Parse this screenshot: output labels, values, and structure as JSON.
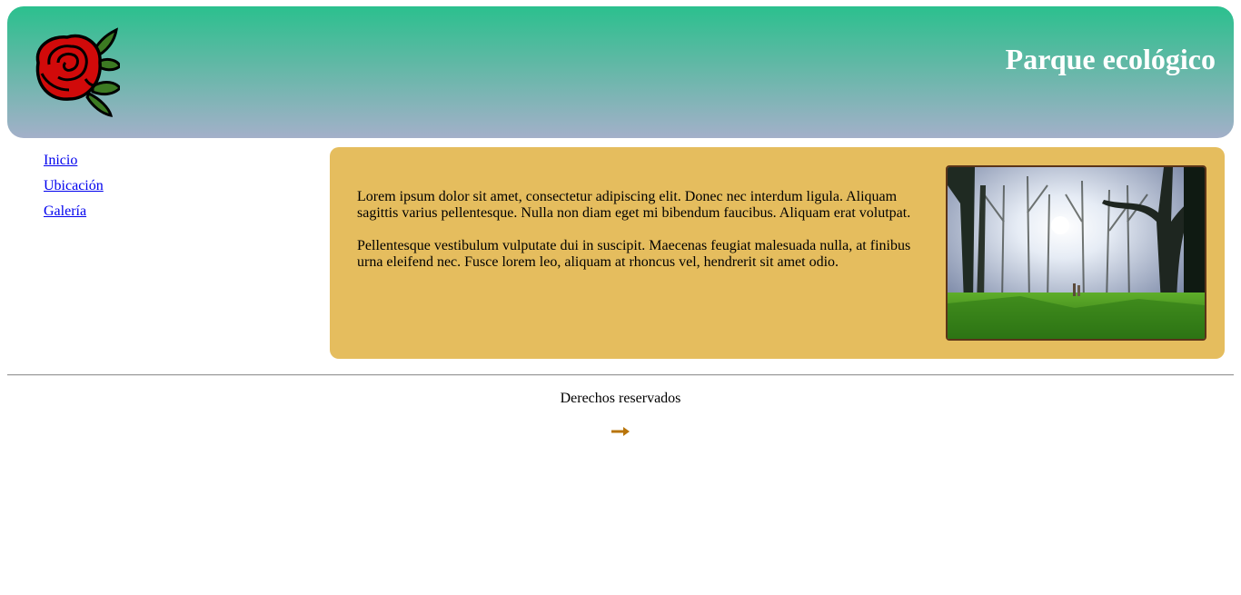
{
  "header": {
    "title": "Parque ecológico",
    "logo_icon": "rose-icon"
  },
  "nav": {
    "items": [
      {
        "label": "Inicio"
      },
      {
        "label": "Ubicación"
      },
      {
        "label": "Galería"
      }
    ]
  },
  "main": {
    "paragraphs": [
      "Lorem ipsum dolor sit amet, consectetur adipiscing elit. Donec nec interdum ligula. Aliquam sagittis varius pellentesque. Nulla non diam eget mi bibendum faucibus. Aliquam erat volutpat.",
      "Pellentesque vestibulum vulputate dui in suscipit. Maecenas feugiat malesuada nulla, at finibus urna eleifend nec. Fusce lorem leo, aliquam at rhoncus vel, hendrerit sit amet odio."
    ],
    "image_icon": "forest-photo"
  },
  "footer": {
    "text": "Derechos reservados",
    "arrow_icon": "arrow-right-icon"
  },
  "colors": {
    "header_top": "#2bc08e",
    "header_bottom": "#a3b0c9",
    "content_bg": "#e5bd5e",
    "link": "#0000ee",
    "arrow": "#b8740a"
  }
}
